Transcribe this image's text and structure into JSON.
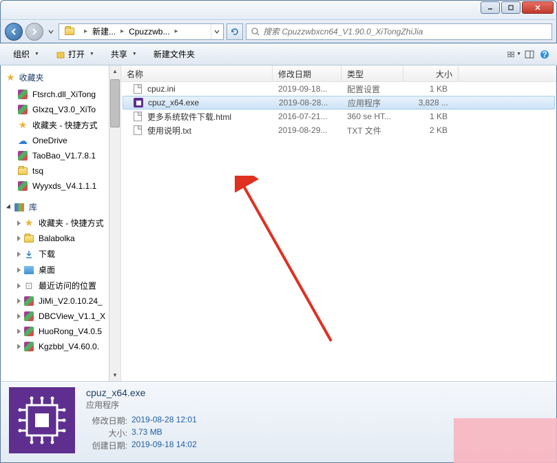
{
  "breadcrumb": {
    "items": [
      "新建...",
      "Cpuzzwb..."
    ]
  },
  "search": {
    "placeholder": "搜索 Cpuzzwbxcn64_V1.90.0_XiTongZhiJia"
  },
  "toolbar": {
    "organize": "组织",
    "open": "打开",
    "share": "共享",
    "newfolder": "新建文件夹"
  },
  "columns": {
    "name": "名称",
    "modified": "修改日期",
    "type": "类型",
    "size": "大小"
  },
  "sidebar": {
    "favorites": "收藏夹",
    "items1": [
      {
        "label": "Ftsrch.dll_XiTong",
        "icon": "rar"
      },
      {
        "label": "Glxzq_V3.0_XiTo",
        "icon": "rar"
      },
      {
        "label": "收藏夹 - 快捷方式",
        "icon": "star"
      },
      {
        "label": "OneDrive",
        "icon": "cloud"
      },
      {
        "label": "TaoBao_V1.7.8.1",
        "icon": "rar"
      },
      {
        "label": "tsq",
        "icon": "folder"
      },
      {
        "label": "Wyyxds_V4.1.1.1",
        "icon": "rar"
      }
    ],
    "libraries": "库",
    "items2": [
      {
        "label": "收藏夹 - 快捷方式",
        "icon": "star"
      },
      {
        "label": "Balabolka",
        "icon": "folder"
      },
      {
        "label": "下载",
        "icon": "dl"
      },
      {
        "label": "桌面",
        "icon": "desk"
      },
      {
        "label": "最近访问的位置",
        "icon": "drive"
      },
      {
        "label": "JiMi_V2.0.10.24_",
        "icon": "rar"
      },
      {
        "label": "DBCView_V1.1_X",
        "icon": "rar"
      },
      {
        "label": "HuoRong_V4.0.5",
        "icon": "rar"
      },
      {
        "label": "Kgzbbl_V4.60.0.",
        "icon": "rar"
      }
    ]
  },
  "files": [
    {
      "name": "cpuz.ini",
      "date": "2019-09-18...",
      "type": "配置设置",
      "size": "1 KB",
      "icon": "file",
      "selected": false
    },
    {
      "name": "cpuz_x64.exe",
      "date": "2019-08-28...",
      "type": "应用程序",
      "size": "3,828 ...",
      "icon": "exe",
      "selected": true
    },
    {
      "name": "更多系统软件下载.html",
      "date": "2016-07-21...",
      "type": "360 se HT...",
      "size": "1 KB",
      "icon": "file",
      "selected": false
    },
    {
      "name": "使用说明.txt",
      "date": "2019-08-29...",
      "type": "TXT 文件",
      "size": "2 KB",
      "icon": "file",
      "selected": false
    }
  ],
  "details": {
    "name": "cpuz_x64.exe",
    "type": "应用程序",
    "mod_label": "修改日期:",
    "mod_val": "2019-08-28 12:01",
    "size_label": "大小:",
    "size_val": "3.73 MB",
    "created_label": "创建日期:",
    "created_val": "2019-09-18 14:02"
  }
}
